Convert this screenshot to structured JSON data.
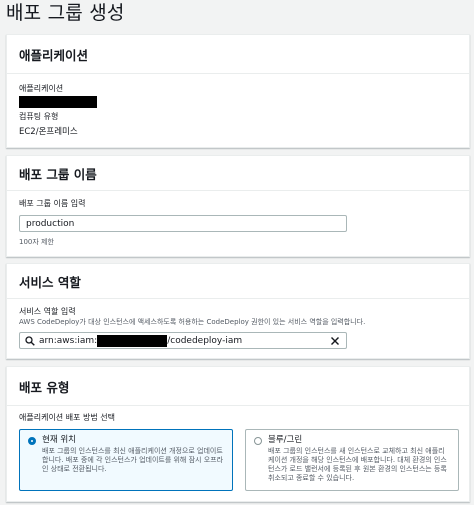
{
  "page": {
    "title": "배포 그룹 생성"
  },
  "application_section": {
    "header": "애플리케이션",
    "app_label": "애플리케이션",
    "compute_label": "컴퓨팅 유형",
    "compute_value": "EC2/온프레미스"
  },
  "group_name_section": {
    "header": "배포 그룹 이름",
    "input_label": "배포 그룹 이름 입력",
    "input_value": "production",
    "constraint": "100자 제한"
  },
  "service_role_section": {
    "header": "서비스 역할",
    "input_label": "서비스 역할 입력",
    "description": "AWS CodeDeploy가 대상 인스턴스에 액세스하도록 허용하는 CodeDeploy 권한이 있는 서비스 역할을 입력합니다.",
    "arn_prefix": "arn:aws:iam:",
    "arn_suffix": "/codedeploy-iam",
    "search_icon": "search-icon",
    "clear_icon": "close-icon"
  },
  "deployment_type_section": {
    "header": "배포 유형",
    "choice_label": "애플리케이션 배포 방법 선택",
    "options": [
      {
        "title": "현재 위치",
        "description": "배포 그룹의 인스턴스를 최신 애플리케이션 개정으로 업데이트합니다. 배포 중에 각 인스턴스가 업데이트를 위해 잠시 오프라인 상태로 전환됩니다.",
        "selected": true
      },
      {
        "title": "블루/그린",
        "description": "배포 그룹의 인스턴스를 새 인스턴스로 교체하고 최신 애플리케이션 개정을 해당 인스턴스에 배포합니다. 대체 환경의 인스턴스가 로드 밸런서에 등록된 후 원본 환경의 인스턴스는 등록 취소되고 종료할 수 있습니다.",
        "selected": false
      }
    ]
  },
  "colors": {
    "accent": "#0073bb",
    "page_bg": "#f2f3f3",
    "panel_border": "#eaeded"
  }
}
